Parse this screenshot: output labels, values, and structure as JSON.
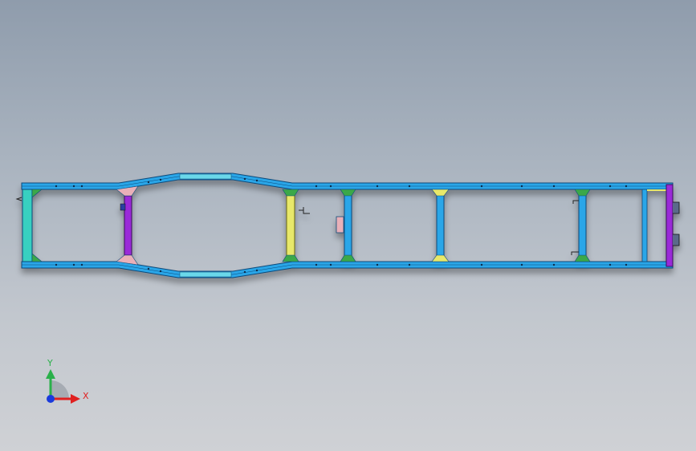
{
  "colors": {
    "rail": "#2aa6e8",
    "rail_edge": "#0d4a7a",
    "gusset": "#3aa84a",
    "gusset_pink": "#e9b0b8",
    "cross_yellow": "#e8e86a",
    "cross_purple": "#9a2ad8",
    "cross_cyan": "#39d0c0",
    "axis_x": "#e02020",
    "axis_y": "#2ab04a",
    "axis_z": "#1a3adc"
  },
  "triad": {
    "x_label": "X",
    "y_label": "Y"
  }
}
